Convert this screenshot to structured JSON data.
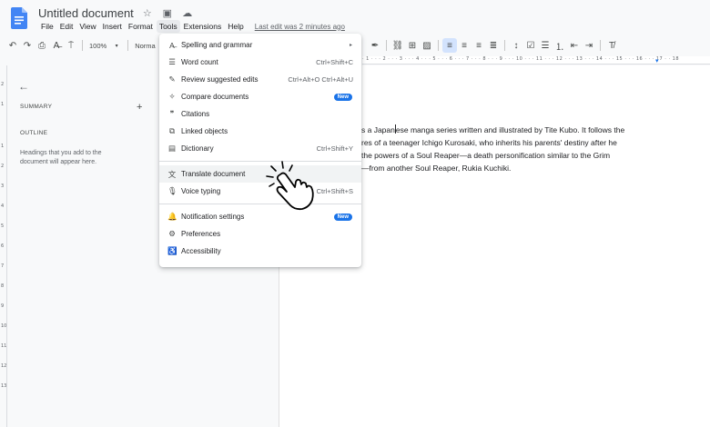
{
  "header": {
    "title": "Untitled document",
    "title_icons": [
      "star-icon",
      "move-to-folder-icon",
      "cloud-status-icon"
    ],
    "menus": [
      "File",
      "Edit",
      "View",
      "Insert",
      "Format",
      "Tools",
      "Extensions",
      "Help"
    ],
    "active_menu": "Tools",
    "last_edit": "Last edit was 2 minutes ago"
  },
  "toolbar": {
    "zoom": "100%",
    "style": "Norma"
  },
  "ruler_text": "· 1 · · · 2 · · · 3 · · · 4 · · · 5 · · · 6 · · · 7 · · · 8 · · · 9 · · · 10 · · · 11 · · · 12 · · · 13 · · · 14 · · · 15 · · · 16 · · · 17 · · 18",
  "ruler_vertical": [
    "2",
    "1",
    "1",
    "2",
    "3",
    "4",
    "5",
    "6",
    "7",
    "8",
    "9",
    "10",
    "11",
    "12",
    "13"
  ],
  "sidebar": {
    "summary_label": "SUMMARY",
    "add_label": "+",
    "outline_label": "OUTLINE",
    "outline_note": "Headings that you add to the document will appear here."
  },
  "document": {
    "line1_before_cursor": "s a Japan",
    "line1_after_cursor": "ese manga series written and illustrated by Tite Kubo. It follows the",
    "line2": "res of a teenager Ichigo Kurosaki, who inherits his parents' destiny after he",
    "line3": "the powers of a Soul Reaper—a death personification similar to the Grim",
    "line4": "—from another Soul Reaper, Rukia Kuchiki."
  },
  "tools_menu": {
    "group1": [
      {
        "icon": "spellcheck-icon",
        "glyph": "A̶",
        "label": "Spelling and grammar",
        "submenu": "▸"
      },
      {
        "icon": "word-count-icon",
        "glyph": "☰",
        "label": "Word count",
        "shortcut": "Ctrl+Shift+C"
      },
      {
        "icon": "review-edits-icon",
        "glyph": "✎",
        "label": "Review suggested edits",
        "shortcut": "Ctrl+Alt+O Ctrl+Alt+U"
      },
      {
        "icon": "compare-documents-icon",
        "glyph": "✧",
        "label": "Compare documents",
        "badge": "New"
      },
      {
        "icon": "citations-icon",
        "glyph": "❞",
        "label": "Citations"
      },
      {
        "icon": "linked-objects-icon",
        "glyph": "⧉",
        "label": "Linked objects"
      },
      {
        "icon": "dictionary-icon",
        "glyph": "▤",
        "label": "Dictionary",
        "shortcut": "Ctrl+Shift+Y"
      }
    ],
    "group2": [
      {
        "icon": "translate-icon",
        "glyph": "文",
        "label": "Translate document"
      },
      {
        "icon": "microphone-icon",
        "glyph": "🎙",
        "label": "Voice typing",
        "shortcut": "Ctrl+Shift+S"
      }
    ],
    "group3": [
      {
        "icon": "bell-icon",
        "glyph": "🔔",
        "label": "Notification settings",
        "badge": "New"
      },
      {
        "icon": "preferences-icon",
        "glyph": "⚙",
        "label": "Preferences"
      },
      {
        "icon": "accessibility-icon",
        "glyph": "♿",
        "label": "Accessibility"
      }
    ]
  },
  "colors": {
    "accent": "#1a73e8",
    "doc_icon": "#4285f4",
    "hover_row": "#f1f3f4"
  }
}
